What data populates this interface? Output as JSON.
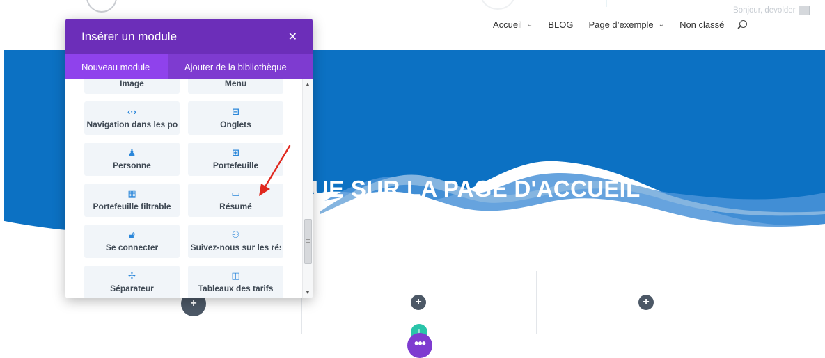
{
  "topnav": {
    "greeting": "Bonjour, devolder",
    "menu": [
      {
        "label": "Accueil",
        "has_dropdown": true
      },
      {
        "label": "BLOG",
        "has_dropdown": false
      },
      {
        "label": "Page d’exemple",
        "has_dropdown": true
      },
      {
        "label": "Non classé",
        "has_dropdown": false
      }
    ],
    "dropdown_glyph": "⌄",
    "search_icon": "search-icon"
  },
  "hero": {
    "title": "UE SUR LA PAGE D'ACCUEIL",
    "colors": {
      "primary": "#0c71c3",
      "wave_light": "#85b5e0",
      "wave_mid": "#4b93d8"
    }
  },
  "builder": {
    "add_glyph": "+",
    "more_glyph": "•••",
    "colors": {
      "add": "#4c5866",
      "teal": "#29c4a9",
      "purple": "#7e3bd0"
    }
  },
  "modal": {
    "title": "Insérer un module",
    "close_glyph": "✕",
    "tabs": {
      "new": "Nouveau module",
      "library": "Ajouter de la bibliothèque"
    },
    "colors": {
      "header": "#6c2eb9",
      "tabs": "#7e3bd0",
      "active_tab": "#8f42ec",
      "icon": "#2b87da"
    },
    "modules": [
      {
        "label": "Image",
        "icon": "▭",
        "icon_name": "image-icon"
      },
      {
        "label": "Menu",
        "icon": "☰",
        "icon_name": "menu-icon"
      },
      {
        "label": "Navigation dans les pos",
        "icon": "‹·›",
        "icon_name": "post-navigation-icon"
      },
      {
        "label": "Onglets",
        "icon": "⊟",
        "icon_name": "tabs-icon"
      },
      {
        "label": "Personne",
        "icon": "♟",
        "icon_name": "person-icon"
      },
      {
        "label": "Portefeuille",
        "icon": "⊞",
        "icon_name": "portfolio-icon"
      },
      {
        "label": "Portefeuille filtrable",
        "icon": "▦",
        "icon_name": "filterable-portfolio-icon"
      },
      {
        "label": "Résumé",
        "icon": "▭",
        "icon_name": "summary-icon"
      },
      {
        "label": "Se connecter",
        "icon": "🔓︎",
        "icon_name": "login-icon"
      },
      {
        "label": "Suivez-nous sur les rése",
        "icon": "⚇",
        "icon_name": "social-follow-icon"
      },
      {
        "label": "Séparateur",
        "icon": "✢",
        "icon_name": "divider-icon"
      },
      {
        "label": "Tableaux des tarifs",
        "icon": "◫",
        "icon_name": "pricing-tables-icon"
      }
    ],
    "scroll": {
      "up": "▲",
      "down": "▼"
    }
  },
  "annotation": {
    "arrow_color": "#e0281e"
  }
}
